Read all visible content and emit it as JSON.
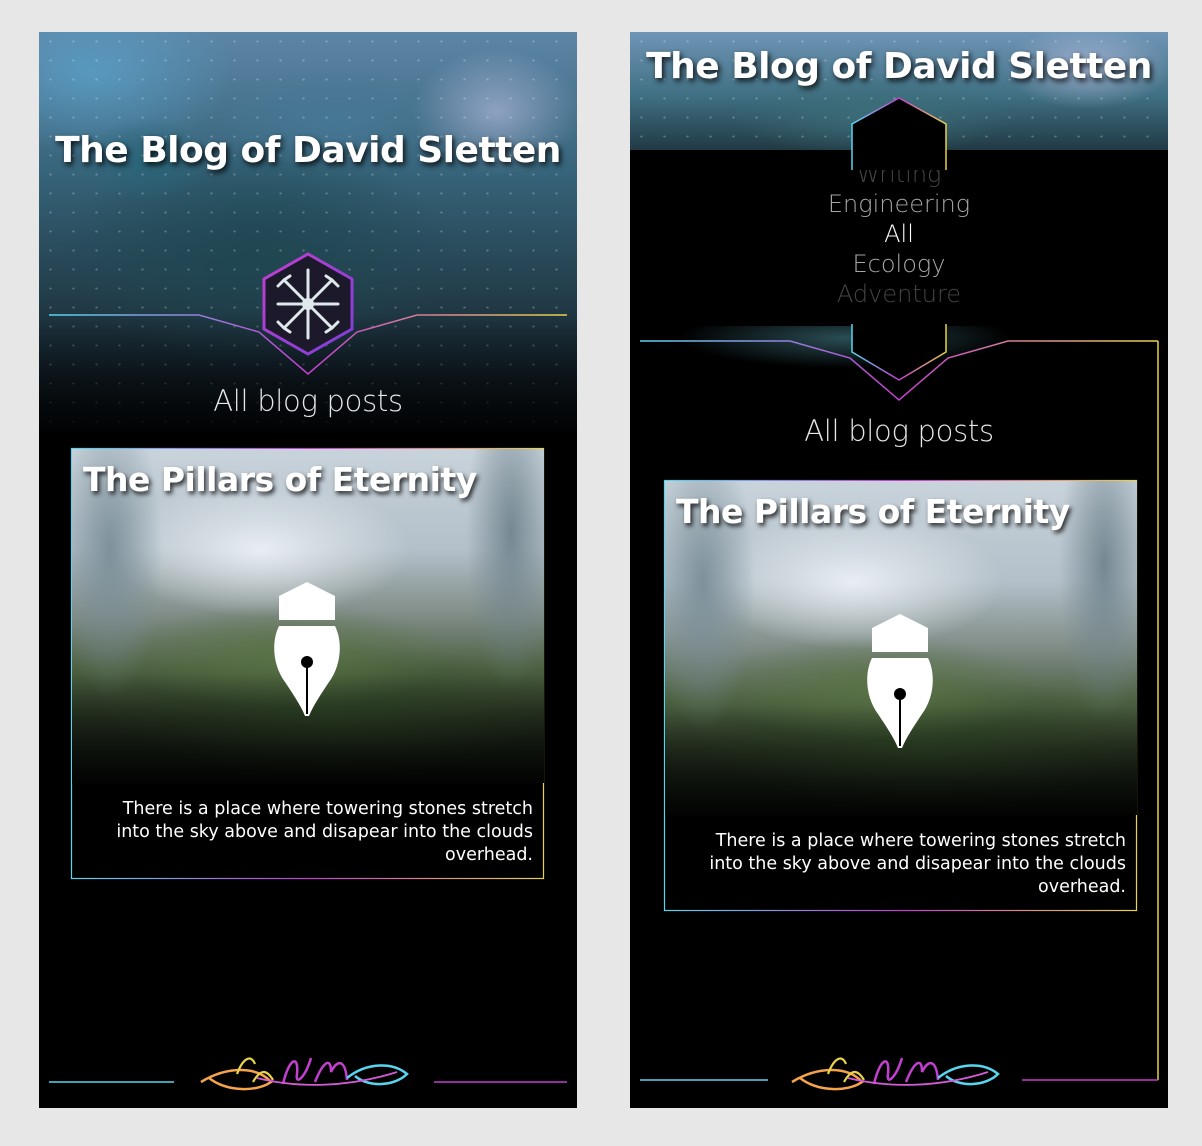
{
  "blog": {
    "title": "The Blog of David Sletten",
    "section_heading": "All blog posts"
  },
  "post": {
    "title": "The Pillars of Eternity",
    "excerpt": "There is a place where towering stones stretch into the sky above and disapear into the clouds overhead.",
    "icon": "fountain-pen-icon"
  },
  "categories": {
    "items": [
      "Writing",
      "Engineering",
      "All",
      "Ecology",
      "Adventure"
    ],
    "selected": "All"
  },
  "logo": {
    "icon": "compass-emblem-icon"
  },
  "signature": {
    "icon": "david-sletten-signature"
  },
  "colors": {
    "background": "#e7e7e7",
    "phone": "#000000",
    "cyan": "#58d6f0",
    "magenta": "#c23fd0",
    "yellow": "#e9d34a",
    "orange": "#f5a44a"
  }
}
